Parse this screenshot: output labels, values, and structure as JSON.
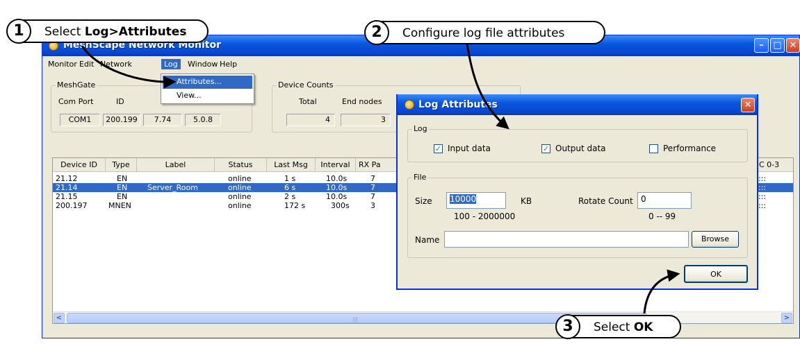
{
  "main_window": {
    "title": "MeshScape Network Monitor",
    "min_glyph": "–",
    "max_glyph": "□",
    "close_glyph": "✕"
  },
  "menu": {
    "items": [
      "Monitor",
      "Edit",
      "Network",
      "Log",
      "Window",
      "Help"
    ],
    "active": "Log"
  },
  "log_menu": {
    "attributes": "Attributes...",
    "view": "View..."
  },
  "meshgate": {
    "title": "MeshGate",
    "com_port_label": "Com Port",
    "id_label": "ID",
    "com_port_value": "COM1",
    "id_value": "200.199",
    "value3": "7.74",
    "value4": "5.0.8"
  },
  "device_counts": {
    "title": "Device Counts",
    "total_label": "Total",
    "end_nodes_label": "End nodes",
    "total_value": "4",
    "end_nodes_value": "3"
  },
  "device_list": {
    "columns": [
      "Device ID",
      "Type",
      "Label",
      "Status",
      "Last Msg",
      "Interval",
      "RX Pa",
      "C 0-3"
    ],
    "rows": [
      {
        "device_id": "21.12",
        "type": "EN",
        "label": "",
        "status": "online",
        "last_msg": "1 s",
        "interval": "10.0s",
        "rx": "7",
        "c03": ":::",
        "selected": false
      },
      {
        "device_id": "21.14",
        "type": "EN",
        "label": "Server_Room",
        "status": "online",
        "last_msg": "6 s",
        "interval": "10.0s",
        "rx": "7",
        "c03": ":::",
        "selected": true
      },
      {
        "device_id": "21.15",
        "type": "EN",
        "label": "",
        "status": "online",
        "last_msg": "2 s",
        "interval": "10.0s",
        "rx": "7",
        "c03": ":::",
        "selected": false
      },
      {
        "device_id": "200.197",
        "type": "MNEN",
        "label": "",
        "status": "online",
        "last_msg": "172 s",
        "interval": "300s",
        "rx": "3",
        "c03": ":::",
        "selected": false
      }
    ],
    "scroll_left": "<",
    "scroll_right": ">",
    "scroll_grip": "|||"
  },
  "dialog": {
    "title": "Log Attributes",
    "close_glyph": "✕",
    "log_group": "Log",
    "input_data": {
      "label": "Input data",
      "checked": true,
      "mark": "✓"
    },
    "output_data": {
      "label": "Output data",
      "checked": true,
      "mark": "✓"
    },
    "performance": {
      "label": "Performance",
      "checked": false,
      "mark": ""
    },
    "file_group": "File",
    "size_label": "Size",
    "size_value": "10000",
    "size_unit": "KB",
    "size_range": "100 - 2000000",
    "rotate_label": "Rotate Count",
    "rotate_value": "0",
    "rotate_range": "0 -- 99",
    "name_label": "Name",
    "name_value": "",
    "browse_label": "Browse",
    "ok_label": "OK"
  },
  "callouts": [
    {
      "number": "1",
      "text_plain": "Select ",
      "text_bold": "Log>Attributes"
    },
    {
      "number": "2",
      "text_plain": "Configure log file attributes",
      "text_bold": ""
    },
    {
      "number": "3",
      "text_plain": "Select ",
      "text_bold": "OK"
    }
  ]
}
